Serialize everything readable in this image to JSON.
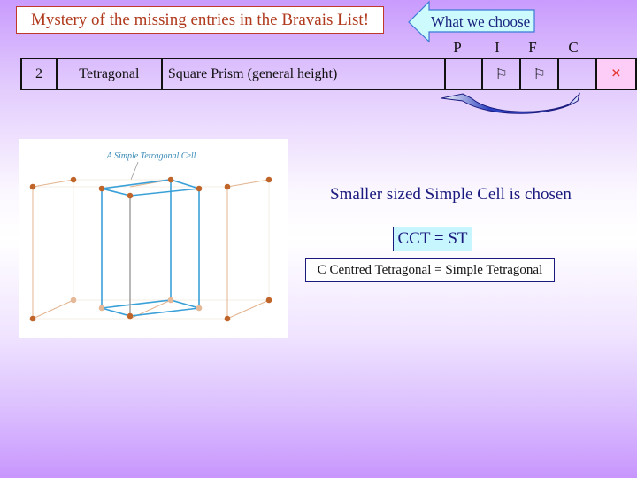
{
  "title": "Mystery of the missing entries in the Bravais List!",
  "callout": {
    "label": "What we choose",
    "icon": "left-arrow-callout"
  },
  "columns": [
    "P",
    "I",
    "F",
    "C"
  ],
  "row": {
    "number": "2",
    "system": "Tetragonal",
    "shape": "Square Prism (general height)",
    "P": {
      "icon": "flag-icon",
      "glyph": "⚐",
      "allowed": true
    },
    "I": {
      "icon": "flag-icon",
      "glyph": "⚐",
      "allowed": true
    },
    "F": {
      "icon": "",
      "glyph": "",
      "allowed": false
    },
    "C": {
      "icon": "cross-icon",
      "glyph": "×",
      "allowed": false
    }
  },
  "diagram": {
    "caption": "A Simple Tetragonal Cell"
  },
  "message": "Smaller sized Simple Cell is chosen",
  "equation": "CCT = ST",
  "equivalence": "C Centred Tetragonal = Simple Tetragonal",
  "colors": {
    "title_text": "#b03a1e",
    "title_border": "#c0392b",
    "navy_text": "#1a1a7e",
    "cct_fill": "#c8f6ff",
    "c_cell_fill": "#fdccf7",
    "cross": "#e53935",
    "lattice_point": "#c0652a",
    "cell_edge": "#3aa0d8",
    "background_purple": "#c99bfd"
  }
}
